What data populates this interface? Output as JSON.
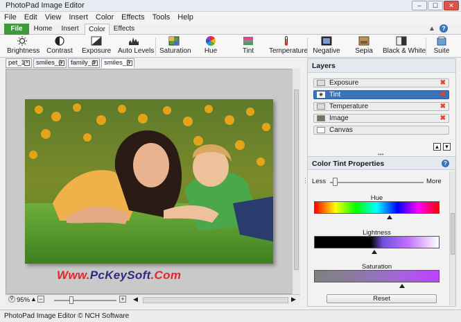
{
  "window": {
    "title": "PhotoPad Image Editor",
    "controls": [
      "–",
      "☐",
      "✕"
    ]
  },
  "menu": [
    "File",
    "Edit",
    "View",
    "Insert",
    "Color",
    "Effects",
    "Tools",
    "Help"
  ],
  "ribbon_tabs": [
    "File",
    "Home",
    "Insert",
    "Color",
    "Effects"
  ],
  "active_ribbon_tab": "Color",
  "ribbon_buttons": [
    "Brightness",
    "Contrast",
    "Exposure",
    "Auto Levels",
    "Saturation",
    "Hue",
    "Tint",
    "Temperature",
    "Negative",
    "Sepia",
    "Black & White",
    "Suite"
  ],
  "doc_tabs": [
    "pet_1",
    "smiles_6",
    "family_4",
    "smiles_5"
  ],
  "active_doc_tab": "smiles_5",
  "zoom": "95%",
  "watermark": {
    "part1": "Www.",
    "part2": "PcKeySoft",
    "part3": ".Com"
  },
  "layers": {
    "title": "Layers",
    "items": [
      {
        "name": "Exposure",
        "selected": false,
        "deletable": true
      },
      {
        "name": "Tint",
        "selected": true,
        "deletable": true
      },
      {
        "name": "Temperature",
        "selected": false,
        "deletable": true
      },
      {
        "name": "Image",
        "selected": false,
        "deletable": true
      },
      {
        "name": "Canvas",
        "selected": false,
        "deletable": false
      }
    ]
  },
  "properties": {
    "title": "Color Tint Properties",
    "less": "Less",
    "more": "More",
    "strength": 0.05,
    "hue_label": "Hue",
    "hue_value": 0.6,
    "lightness_label": "Lightness",
    "lightness_value": 0.48,
    "saturation_label": "Saturation",
    "saturation_value": 0.7,
    "reset": "Reset"
  },
  "status": "PhotoPad Image Editor  © NCH Software",
  "colors": {
    "accent": "#3a73b8",
    "file_tab": "#3c9a3a",
    "delete": "#e0442e"
  }
}
